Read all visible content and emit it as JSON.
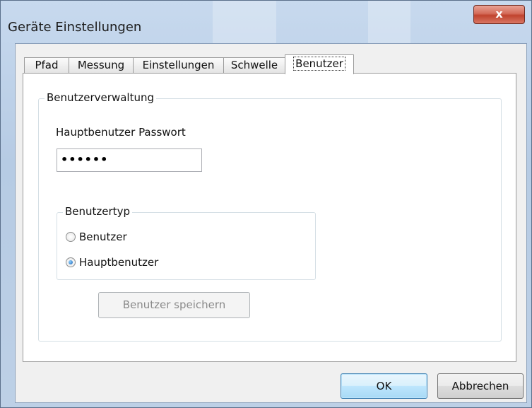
{
  "window": {
    "title": "Geräte Einstellungen",
    "close_glyph": "x"
  },
  "tabs": [
    {
      "label": "Pfad"
    },
    {
      "label": "Messung"
    },
    {
      "label": "Einstellungen"
    },
    {
      "label": "Schwelle"
    },
    {
      "label": "Benutzer"
    }
  ],
  "active_tab": "Benutzer",
  "user_admin": {
    "group_label": "Benutzerverwaltung",
    "password_label": "Hauptbenutzer Passwort",
    "password_value": "••••••",
    "usertype": {
      "group_label": "Benutzertyp",
      "options": [
        {
          "label": "Benutzer",
          "checked": false
        },
        {
          "label": "Hauptbenutzer",
          "checked": true
        }
      ]
    },
    "save_label": "Benutzer speichern"
  },
  "footer": {
    "ok_label": "OK",
    "cancel_label": "Abbrechen"
  },
  "colors": {
    "close_button": "#c7432e",
    "default_button_border": "#3c7fb1"
  }
}
